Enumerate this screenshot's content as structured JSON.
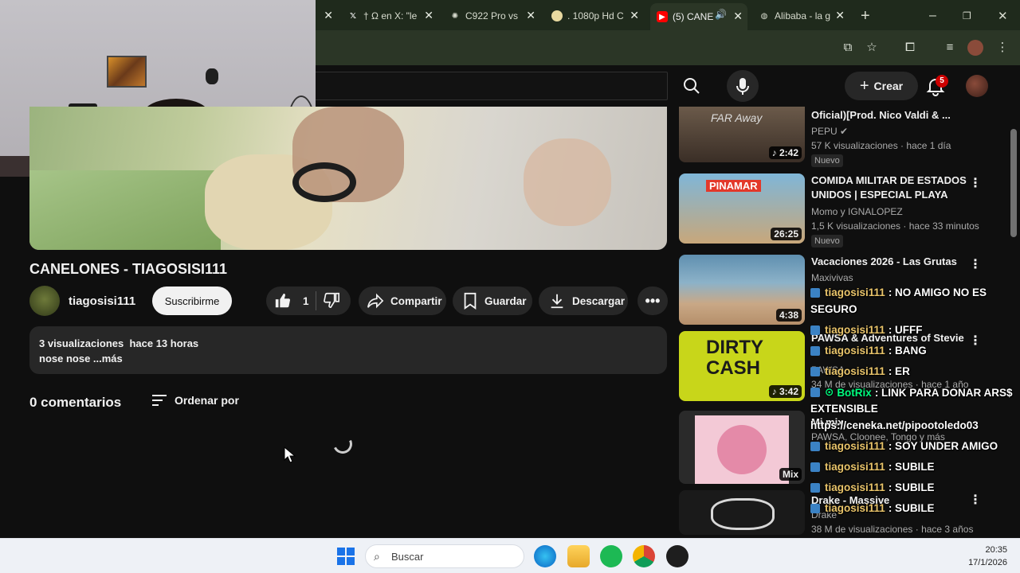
{
  "browser": {
    "tabs": [
      {
        "label": "",
        "active": false
      },
      {
        "label": "† Ω en X: \"le",
        "active": false
      },
      {
        "label": "C922 Pro vs",
        "active": false
      },
      {
        "label": ". 1080p Hd C",
        "active": false
      },
      {
        "label": "(5) CANE",
        "active": true
      },
      {
        "label": "Alibaba - la g",
        "active": false
      }
    ]
  },
  "yt_header": {
    "create_label": "Crear",
    "notification_count": "5"
  },
  "video": {
    "title": "CANELONES - TIAGOSISI111",
    "channel": "tiagosisi111",
    "subscribe_label": "Suscribirme",
    "likes": "1",
    "share_label": "Compartir",
    "save_label": "Guardar",
    "download_label": "Descargar",
    "description_stats": "3 visualizaciones  hace 13 horas",
    "description_text": "nose nose ...más"
  },
  "comments": {
    "count_label": "0 comentarios",
    "sort_label": "Ordenar por"
  },
  "recommendations": [
    {
      "title": "Oficial)[Prod. Nico Valdi & ...",
      "channel": "PEPU",
      "meta": "57 K visualizaciones · hace 1 día",
      "duration": "2:42",
      "badge": "Nuevo",
      "thumb_text": "FAR Away"
    },
    {
      "title": "COMIDA MILITAR DE ESTADOS UNIDOS | ESPECIAL PLAYA",
      "channel": "Momo  y IGNALOPEZ",
      "meta": "1,5 K visualizaciones · hace 33 minutos",
      "duration": "26:25",
      "badge": "Nuevo",
      "thumb_text": "PINAMAR"
    },
    {
      "title": "Vacaciones 2026 - Las Grutas",
      "channel": "Maxivivas",
      "meta": "",
      "duration": "4:38",
      "badge": ""
    },
    {
      "title": "PAWSA & Adventures of Stevie",
      "channel": "PAWSA",
      "meta": "34 M de visualizaciones · hace 1 año",
      "duration": "3:42",
      "badge": "",
      "thumb_text": "DIRTY CASH"
    },
    {
      "title": "Mi mix",
      "channel": "PAWSA, Cloonee, Tongo y más",
      "meta": "",
      "duration": "Mix",
      "badge": ""
    },
    {
      "title": "Drake - Massive",
      "channel": "Drake",
      "meta": "38 M de visualizaciones · hace 3 años",
      "duration": "",
      "badge": ""
    }
  ],
  "chat_overlay": [
    {
      "user": "tiagosisi111",
      "message": ": NO AMIGO NO ES",
      "bot": false
    },
    {
      "user": "",
      "message": "SEGURO",
      "bot": false
    },
    {
      "user": "tiagosisi111",
      "message": ": UFFF",
      "bot": false
    },
    {
      "user": "tiagosisi111",
      "message": ": BANG",
      "bot": false
    },
    {
      "user": "tiagosisi111",
      "message": ": ER",
      "bot": false
    },
    {
      "user": "BotRix",
      "message": ": LINK PARA DONAR ARS$",
      "bot": true
    },
    {
      "user": "",
      "message": "EXTENSIBLE",
      "bot": false
    },
    {
      "user": "",
      "message": "https://ceneka.net/pipootoledo03",
      "bot": false
    },
    {
      "user": "tiagosisi111",
      "message": ": SOY UNDER AMIGO",
      "bot": false
    },
    {
      "user": "tiagosisi111",
      "message": ": SUBILE",
      "bot": false
    },
    {
      "user": "tiagosisi111",
      "message": ": SUBILE",
      "bot": false
    },
    {
      "user": "tiagosisi111",
      "message": ": SUBILE",
      "bot": false
    }
  ],
  "taskbar": {
    "search_placeholder": "Buscar",
    "time": "20:35",
    "date": "17/1/2026"
  }
}
